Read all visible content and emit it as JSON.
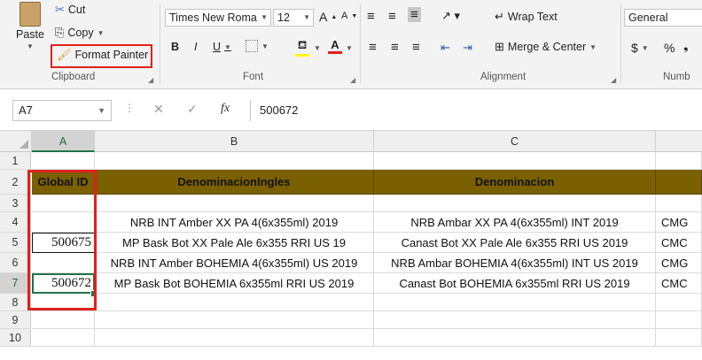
{
  "ribbon": {
    "clipboard": {
      "label": "Clipboard",
      "paste": "Paste",
      "cut": "Cut",
      "copy": "Copy",
      "format_painter": "Format Painter"
    },
    "font": {
      "label": "Font",
      "name": "Times New Roma",
      "size": "12",
      "bold": "B",
      "italic": "I",
      "underline": "U",
      "grow": "A",
      "shrink": "A"
    },
    "alignment": {
      "label": "Alignment",
      "wrap_text": "Wrap Text",
      "merge_center": "Merge & Center"
    },
    "number": {
      "label": "Numb",
      "format": "General",
      "currency": "$",
      "percent": "%"
    }
  },
  "formula_bar": {
    "name_box": "A7",
    "fx": "fx",
    "value": "500672"
  },
  "sheet": {
    "columns": [
      "A",
      "B",
      "C"
    ],
    "rows": [
      "1",
      "2",
      "3",
      "4",
      "5",
      "6",
      "7",
      "8",
      "9",
      "10"
    ],
    "headers": {
      "a": "Global ID",
      "b": "DenominacionIngles",
      "c": "Denominacion",
      "d": ""
    },
    "data": [
      {
        "a": "",
        "b": "NRB INT Amber XX PA 4(6x355ml) 2019",
        "c": "NRB Ambar XX PA 4(6x355ml) INT 2019",
        "d": "CMG"
      },
      {
        "a": "500675",
        "b": "MP Bask Bot XX Pale Ale 6x355 RRI US 19",
        "c": "Canast Bot XX Pale Ale 6x355 RRI US 2019",
        "d": "CMC"
      },
      {
        "a": "",
        "b": "NRB INT Amber BOHEMIA 4(6x355ml) US 2019",
        "c": "NRB Ambar BOHEMIA 4(6x355ml) INT US 2019",
        "d": "CMG"
      },
      {
        "a": "500672",
        "b": "MP Bask Bot BOHEMIA 6x355ml RRI US 2019",
        "c": "Canast Bot BOHEMIA 6x355ml RRI US 2019",
        "d": "CMC"
      }
    ]
  },
  "colors": {
    "header_fill": "#7b6000",
    "selection": "#217346",
    "highlight": "#e0201d"
  }
}
